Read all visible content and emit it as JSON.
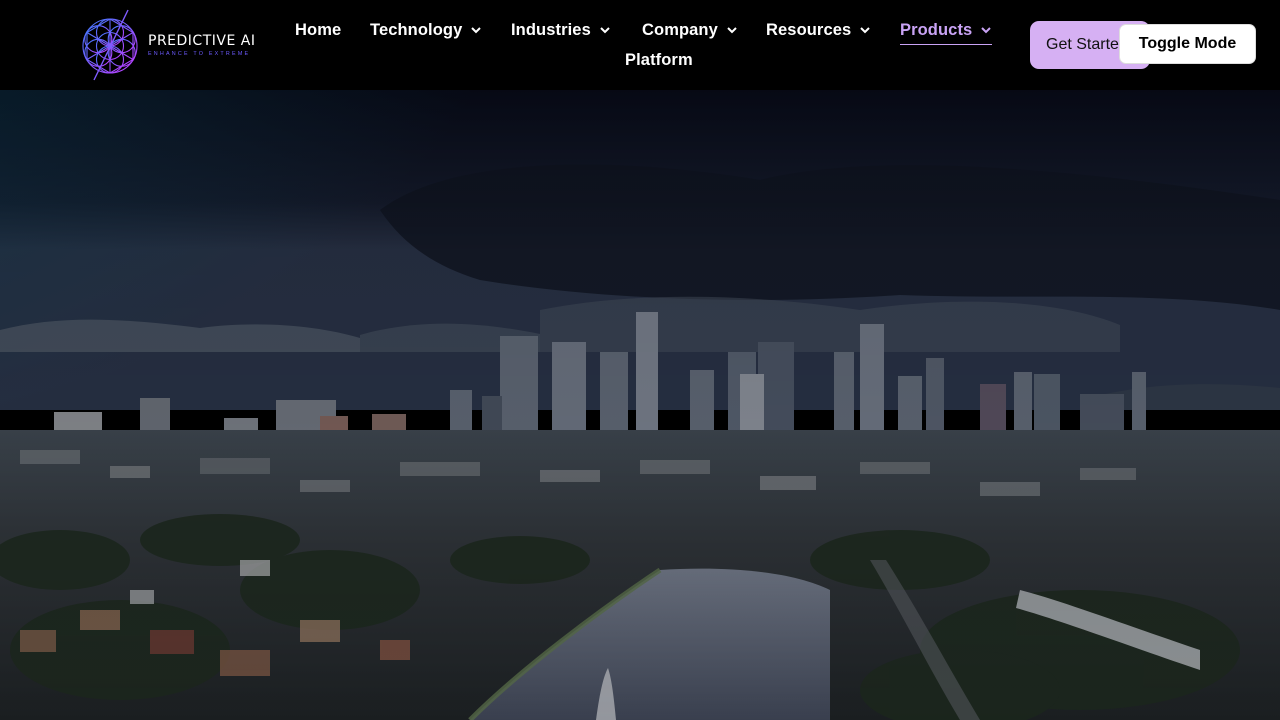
{
  "brand": {
    "name": "PREDICTIVE AI",
    "tagline": "ENHANCE TO EXTREME",
    "accent": "#c9a3f5"
  },
  "nav": {
    "items": [
      {
        "label": "Home",
        "dropdown": false
      },
      {
        "label": "Technology",
        "dropdown": true
      },
      {
        "label": "Industries",
        "dropdown": true
      },
      {
        "label": "Company",
        "dropdown": true
      },
      {
        "label": "Resources",
        "dropdown": true
      },
      {
        "label": "Products",
        "dropdown": true,
        "active": true
      },
      {
        "label": "Platform",
        "dropdown": false
      }
    ]
  },
  "header": {
    "cta_label": "Get Started",
    "toggle_label": "Toggle Mode",
    "cta_color": "#d6b0f3"
  },
  "hero": {
    "image": "aerial-city-skyline-with-lake"
  }
}
